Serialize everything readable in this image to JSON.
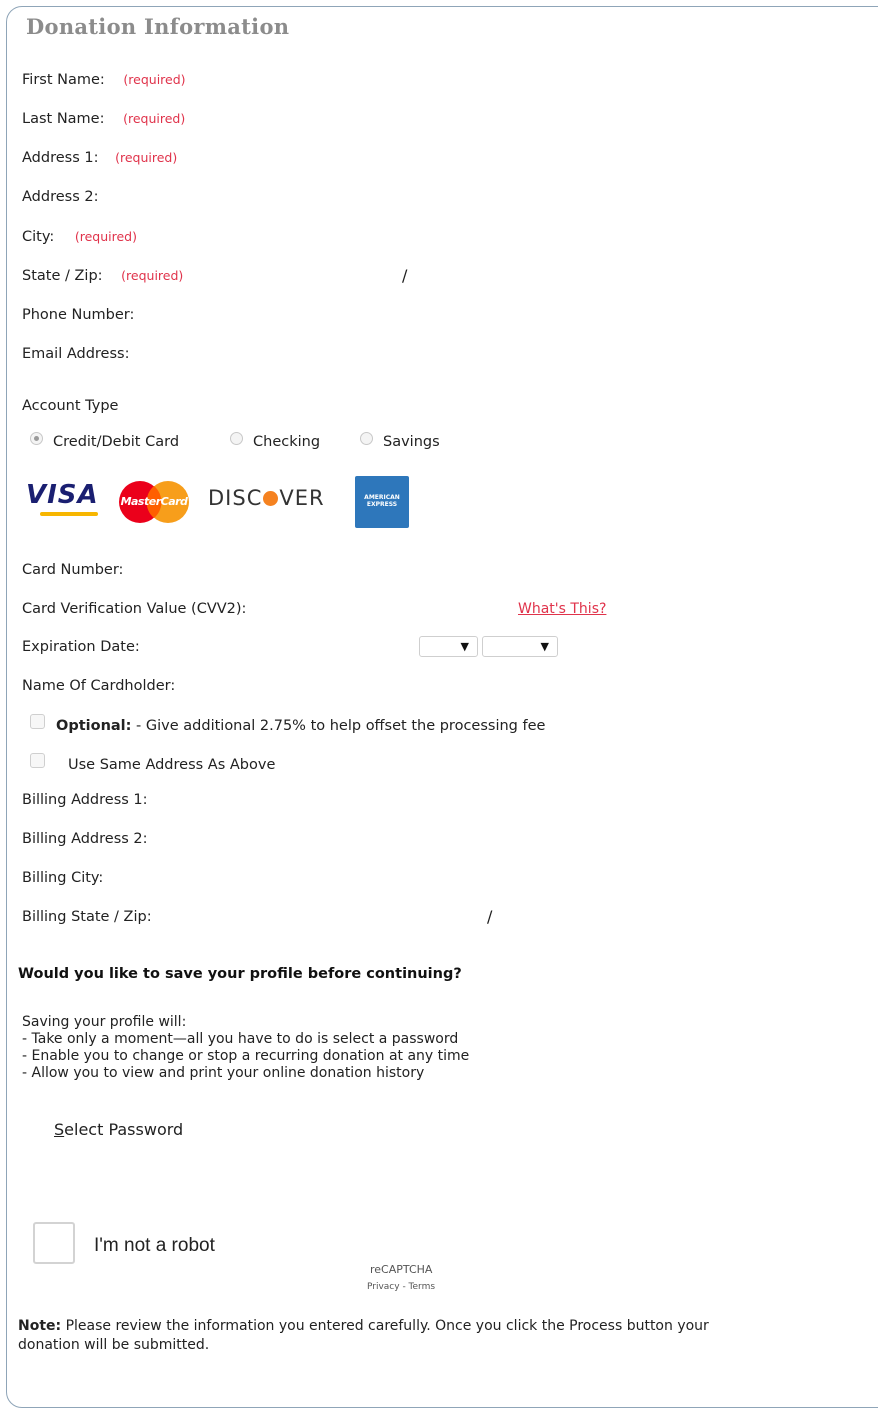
{
  "form": {
    "title": "Donation Information",
    "required_marker": "(required)",
    "fields": {
      "first_name": "First Name:",
      "last_name": "Last Name:",
      "address1": "Address 1:",
      "address2": "Address 2:",
      "city": "City:",
      "state_zip": "State / Zip:",
      "state_zip_sep": "/",
      "phone": "Phone Number:",
      "email": "Email Address:"
    },
    "account_type": {
      "label": "Account Type",
      "options": [
        "Credit/Debit Card",
        "Checking",
        "Savings"
      ],
      "selected": "Credit/Debit Card"
    },
    "card_logos": {
      "visa": "VISA",
      "mastercard": "MasterCard",
      "discover_left": "DISC",
      "discover_right": "VER",
      "amex": "AMERICAN EXPRESS"
    },
    "card": {
      "number": "Card Number:",
      "cvv": "Card Verification Value (CVV2):",
      "whats_this": "What's This?",
      "expiration": "Expiration Date:",
      "cardholder": "Name Of Cardholder:"
    },
    "optional_fee": {
      "bold": "Optional:",
      "text": " - Give additional 2.75% to help offset the processing fee"
    },
    "same_address": "Use Same Address As Above",
    "billing": {
      "address1": "Billing Address 1:",
      "address2": "Billing Address 2:",
      "city": "Billing City:",
      "state_zip": "Billing State / Zip:",
      "state_zip_sep": "/"
    },
    "profile": {
      "question": "Would you like to save your profile before continuing?",
      "intro": "Saving your profile will:",
      "bullets": [
        "- Take only a moment—all you have to do is select a password",
        "- Enable you to change or stop a recurring donation at any time",
        "- Allow you to view and print your online donation history"
      ],
      "select_password_first": "S",
      "select_password_rest": "elect Password"
    },
    "captcha": {
      "label": "I'm not a robot",
      "brand": "reCAPTCHA",
      "links": "Privacy - Terms"
    },
    "note": {
      "bold": "Note:",
      "line1": " Please review the information you entered carefully. Once you click the Process button your",
      "line2": "donation will be submitted."
    }
  },
  "colors": {
    "required": "#e0334b",
    "title": "#8c8c8c",
    "visa_blue": "#1a1f71",
    "mastercard_red": "#eb001b",
    "mastercard_orange": "#f79e1b",
    "amex_blue": "#2e77bb"
  }
}
